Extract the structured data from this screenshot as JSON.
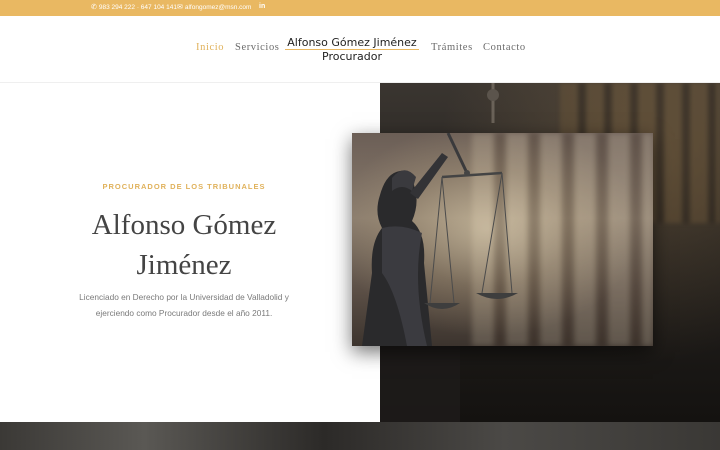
{
  "topbar": {
    "phone": "983 294 222 · 647 104 141",
    "email": "alfongomez@msn.com",
    "linkedin_label": "in"
  },
  "nav": {
    "items": [
      {
        "label": "Inicio",
        "active": true
      },
      {
        "label": "Servicios",
        "active": false
      },
      {
        "label": "Trámites",
        "active": false
      },
      {
        "label": "Contacto",
        "active": false
      }
    ],
    "logo": {
      "line1": "Alfonso Gómez Jiménez",
      "line2": "Procurador"
    }
  },
  "hero": {
    "kicker": "PROCURADOR DE LOS TRIBUNALES",
    "title_line1": "Alfonso Gómez",
    "title_line2": "Jiménez",
    "description": "Licenciado en Derecho por la Universidad de Valladolid y ejerciendo como Procurador desde el año 2011."
  },
  "colors": {
    "accent": "#e9b862",
    "text_dark": "#444444",
    "text_muted": "#7a7a7a"
  },
  "icons": {
    "phone": "phone-icon",
    "email": "envelope-icon",
    "linkedin": "linkedin-icon"
  }
}
